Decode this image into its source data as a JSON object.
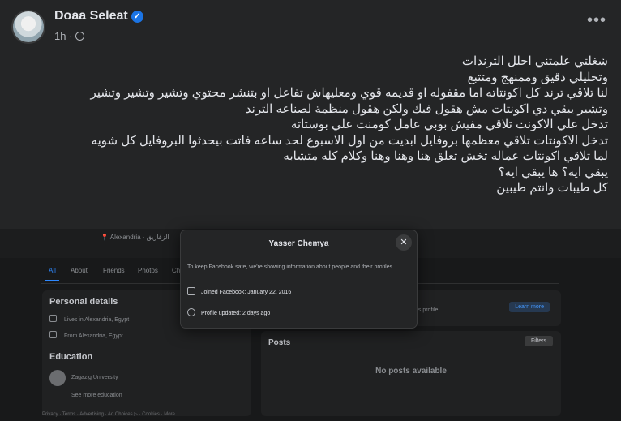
{
  "post": {
    "author": "Doaa Seleat",
    "verified_mark": "✓",
    "time": "1h",
    "separator": "·",
    "privacy_icon": "globe-icon",
    "more_icon": "more-horizontal-icon",
    "more_label": "•••",
    "lines": [
      "شغلتي علمتني احلل الترندات",
      "وتحليلي دقيق وممنهج ومتتبع",
      "لنا تلاقي ترند كل اكونتاته اما مقفوله او قديمه قوي ومعليهاش تفاعل او بتنشر محتوي وتشير وتشير وتشير",
      "وتشير يبقي دي اكونتات مش هقول فيك ولكن هقول منظمة لصناعه الترند",
      "تدخل علي الاكونت تلاقي مفيش بوبي عامل كومنت علي بوستاته",
      "تدخل الاكونتات تلاقي معظمها بروفايل ابديت من اول الاسبوع لحد ساعه فاتت بيحدثوا البروفايل كل شويه",
      "لما تلاقي اكونتات عماله تخش تعلق هنا وهنا وهنا وكلام كله متشابه",
      "يبقي ايه؟ ها يبقي ايه؟",
      "كل طيبات وانتم طيبين"
    ]
  },
  "screenshot": {
    "location_line": "📍 Alexandria  ·  الزقازيق",
    "tabs": [
      "All",
      "About",
      "Friends",
      "Photos",
      "Ch"
    ],
    "personal_details": {
      "title": "Personal details",
      "items": [
        "Lives in Alexandria, Egypt",
        "From Alexandria, Egypt"
      ]
    },
    "education": {
      "title": "Education",
      "school": "Zagazig University",
      "see_more": "See more education"
    },
    "about_hint": "us profile.",
    "learn_more": "Learn more",
    "posts_title": "Posts",
    "filters_label": "Filters",
    "no_posts": "No posts available",
    "footer": "Privacy · Terms · Advertising · Ad Choices ▷ · Cookies · More",
    "popup": {
      "title": "Yasser Chemya",
      "close_label": "✕",
      "note": "To keep Facebook safe, we're showing information about people and their profiles.",
      "joined": "Joined Facebook: January 22, 2016",
      "updated": "Profile updated: 2 days ago"
    }
  },
  "colors": {
    "background": "#242526",
    "text": "#e4e6eb",
    "secondary_text": "#b0b3b8",
    "accent": "#1b74e4"
  }
}
